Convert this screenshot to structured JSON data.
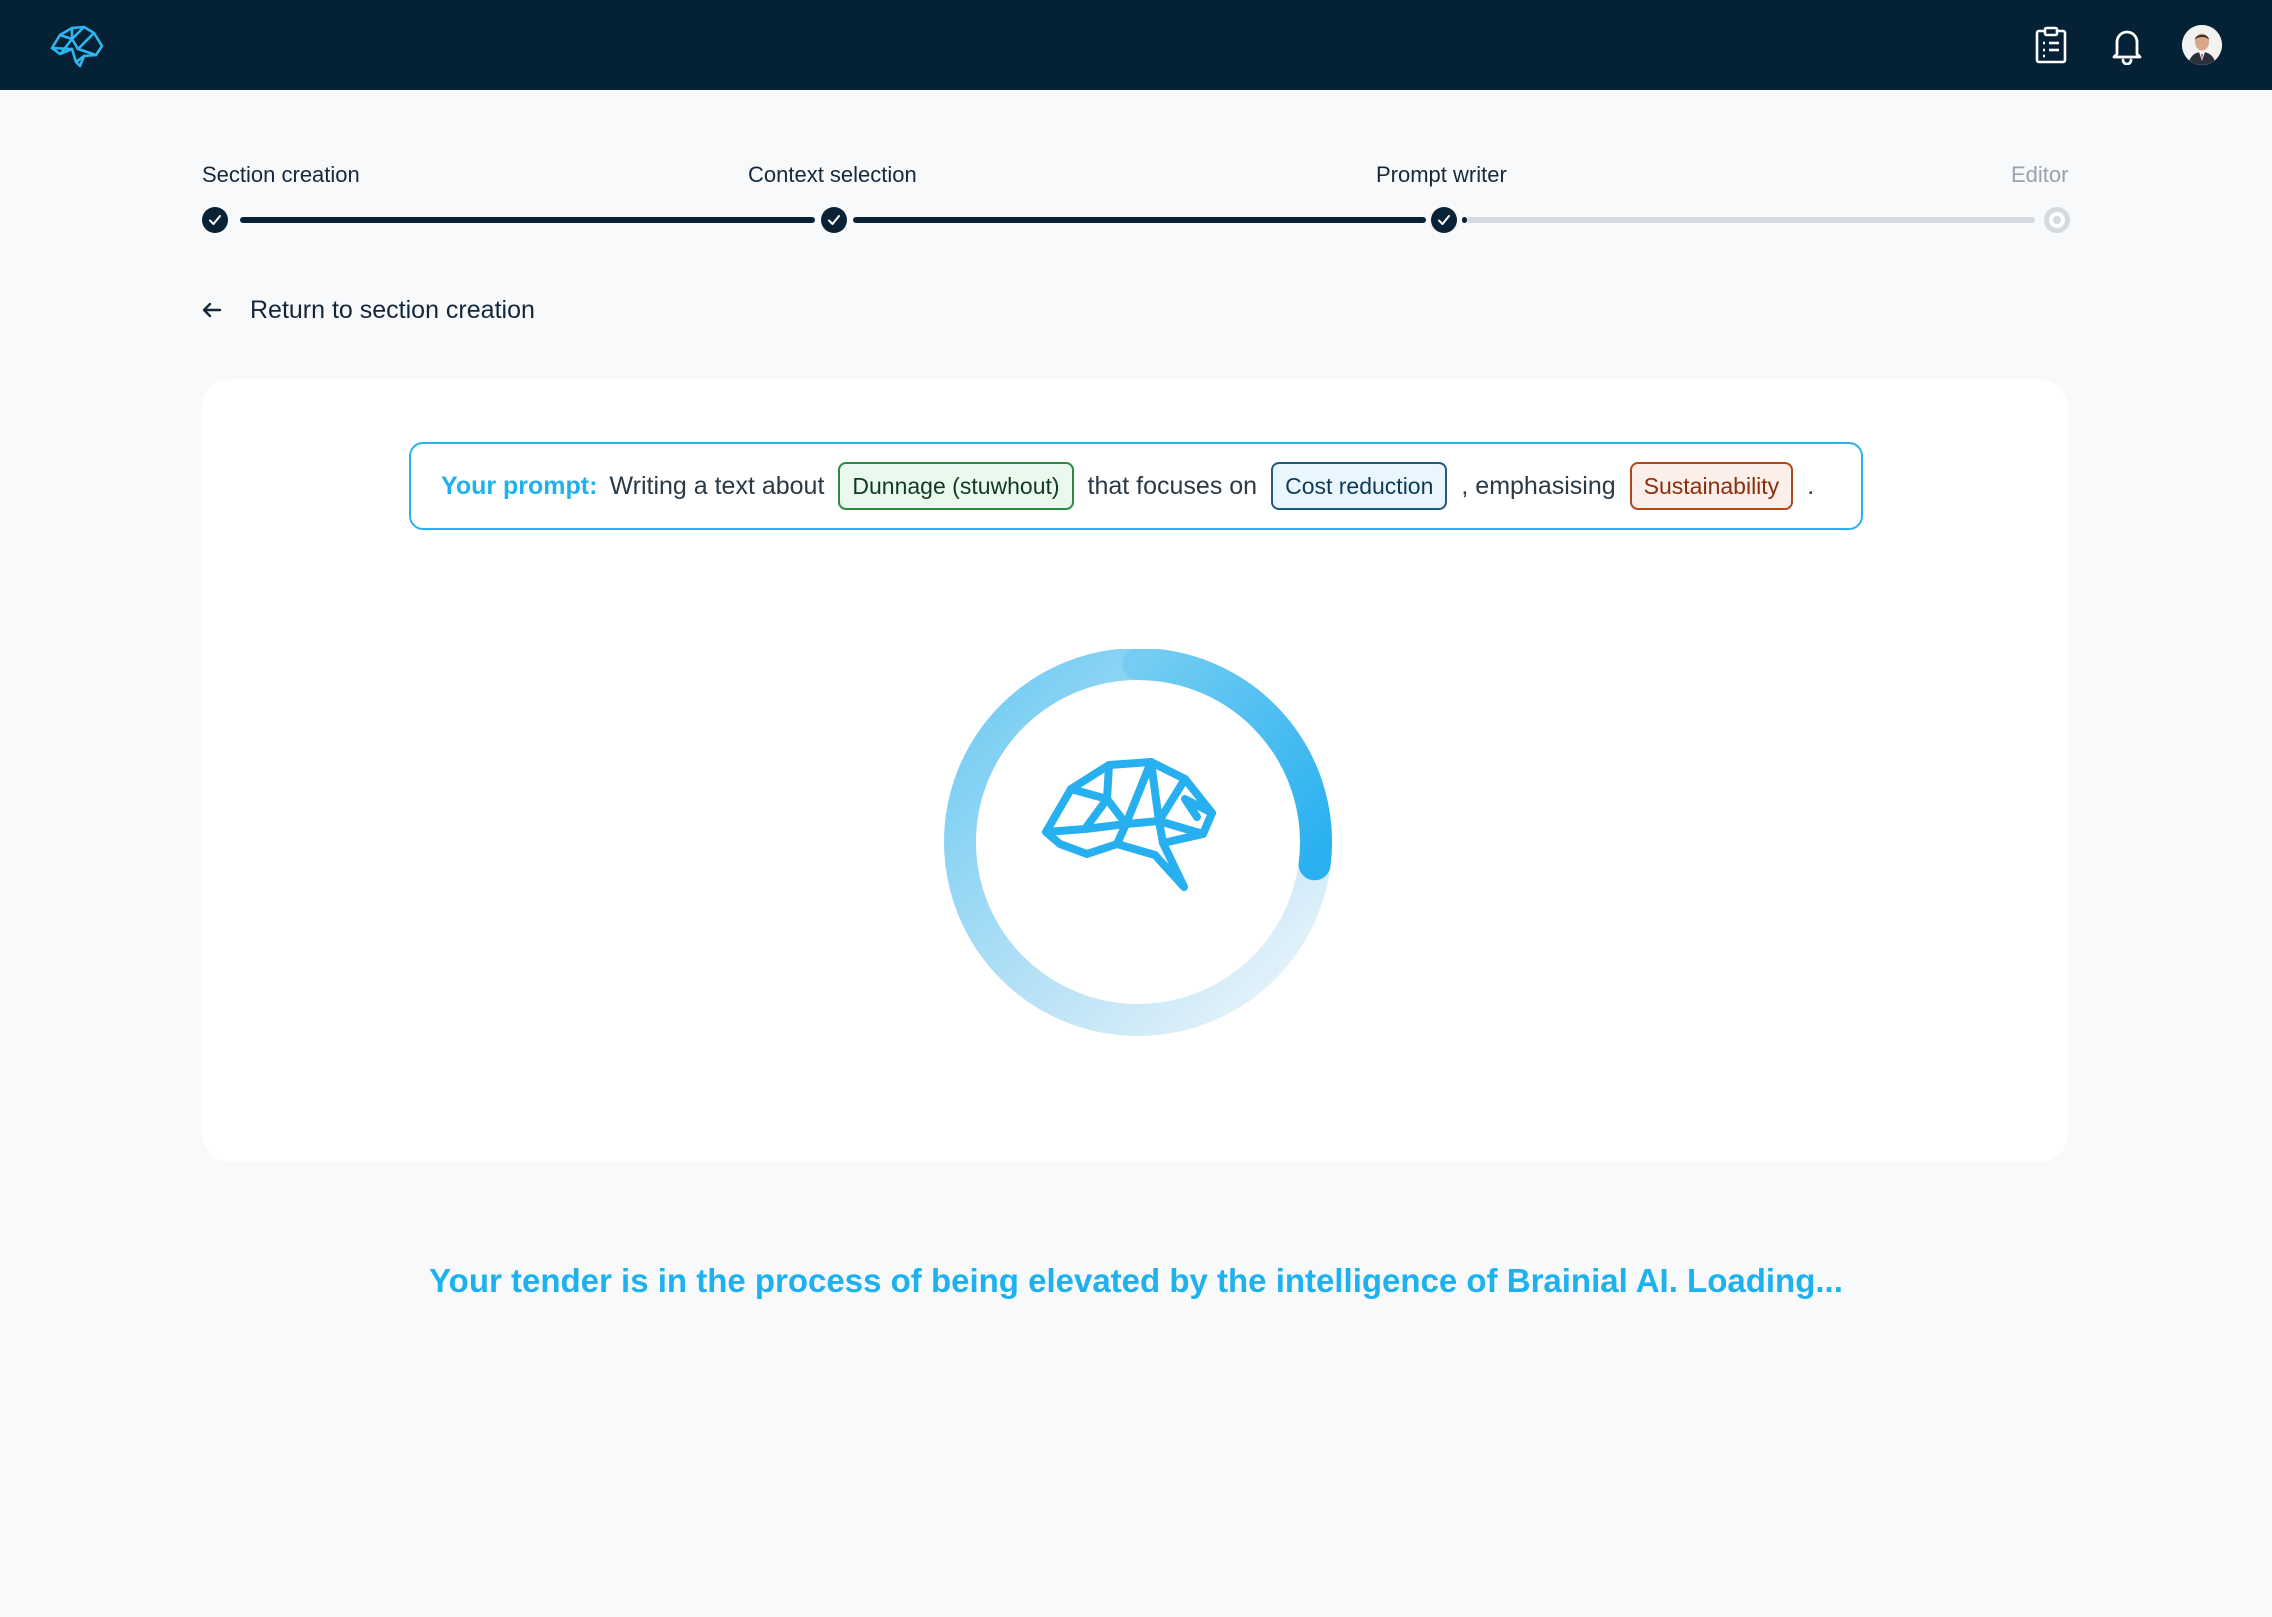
{
  "app": {
    "logo_icon": "brain-icon",
    "header_icons": [
      "clipboard-icon",
      "bell-icon",
      "user-avatar"
    ]
  },
  "stepper": {
    "steps": [
      {
        "label": "Section creation",
        "status": "done"
      },
      {
        "label": "Context selection",
        "status": "done"
      },
      {
        "label": "Prompt writer",
        "status": "done"
      },
      {
        "label": "Editor",
        "status": "pending"
      }
    ]
  },
  "back_link": {
    "label": "Return to section creation",
    "icon": "arrow-left-icon"
  },
  "prompt": {
    "label": "Your prompt:",
    "text1": "Writing a text about",
    "topic": "Dunnage (stuwhout)",
    "text2": "that focuses on",
    "focus": "Cost reduction",
    "text3": ", emphasising",
    "emphasis": "Sustainability",
    "end": "."
  },
  "loader": {
    "icon": "brain-icon",
    "progress": 0.27
  },
  "status_message": "Your tender is in the process of being elevated by the intelligence of Brainial AI. Loading...",
  "colors": {
    "accent": "#1fb1ee",
    "header": "#042135",
    "green": "#2a8b41",
    "blue": "#1d5b83",
    "orange": "#b2461c"
  }
}
